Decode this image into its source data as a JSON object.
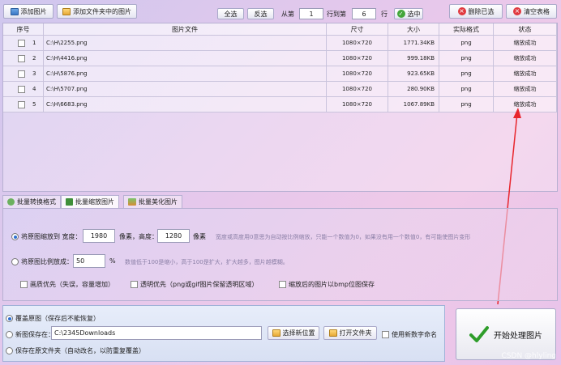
{
  "toolbar": {
    "add_image": "添加图片",
    "add_folder": "添加文件夹中的图片",
    "select_all": "全选",
    "invert": "反选",
    "from_label": "从第",
    "from_value": "1",
    "to_label": "行到第",
    "to_value": "6",
    "row_label": "行",
    "select_btn": "选中",
    "delete_selected": "删除已选",
    "clear_table": "清空表格"
  },
  "table": {
    "headers": [
      "序号",
      "图片文件",
      "尺寸",
      "大小",
      "实际格式",
      "状态"
    ],
    "rows": [
      {
        "no": "1",
        "file": "C:\\H\\2255.png",
        "dim": "1080×720",
        "size": "1771.34KB",
        "fmt": "png",
        "status": "缩放成功"
      },
      {
        "no": "2",
        "file": "C:\\H\\4416.png",
        "dim": "1080×720",
        "size": "999.18KB",
        "fmt": "png",
        "status": "缩放成功"
      },
      {
        "no": "3",
        "file": "C:\\H\\5876.png",
        "dim": "1080×720",
        "size": "923.65KB",
        "fmt": "png",
        "status": "缩放成功"
      },
      {
        "no": "4",
        "file": "C:\\H\\5707.png",
        "dim": "1080×720",
        "size": "280.90KB",
        "fmt": "png",
        "status": "缩放成功"
      },
      {
        "no": "5",
        "file": "C:\\H\\6683.png",
        "dim": "1080×720",
        "size": "1067.89KB",
        "fmt": "png",
        "status": "缩放成功"
      }
    ]
  },
  "tabs": [
    "批量转换格式",
    "批量缩放图片",
    "批量美化图片"
  ],
  "scale": {
    "option1": "将原图缩放到 宽度：",
    "width": "1980",
    "px_height_label": "像素，高度：",
    "height": "1280",
    "px_label": "像素",
    "hint1": "宽度或高度用0意思为自动按比例缩放，只能一个数值为0，如果没有用一个数值0，有可能使图片变形",
    "option2": "将原图比例放成：",
    "ratio": "50",
    "percent": "%",
    "hint2": "数值低于100是缩小，高于100是扩大，扩大越多，图片越模糊。",
    "cb_quality": "画质优先（失误，容量增加）",
    "cb_transparent": "透明优先（png或gif图片保留透明区域）",
    "cb_bmp": "缩放后的图片以bmp位图保存"
  },
  "output": {
    "overwrite": "覆盖原图（保存后不能恢复）",
    "save_new": "新图保存在：",
    "path": "C:\\2345Downloads",
    "choose_btn": "选择新位置",
    "open_btn": "打开文件夹",
    "new_name": "使用新数字命名",
    "keep_folder": "保存在原文件夹（自动改名，以防重复覆盖）"
  },
  "start_label": "开始处理图片",
  "watermark": "CSDN @hlyling",
  "colors": {
    "arrow": "#e8262d",
    "accent": "#2d6fd1"
  }
}
